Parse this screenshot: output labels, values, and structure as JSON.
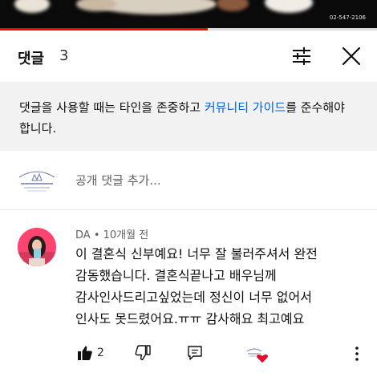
{
  "video": {
    "corner_text": "02-547-2106",
    "progress_percent": 55
  },
  "header": {
    "title": "댓글",
    "count": "3",
    "sort_icon": "sort-sliders-icon",
    "close_icon": "close-icon"
  },
  "notice": {
    "text_before": "댓글을 사용할 때는 타인을 존중하고 ",
    "link_text": "커뮤니티 가이드",
    "text_after": "를 준수해야 합니다."
  },
  "add_comment": {
    "placeholder": "공개 댓글 추가..."
  },
  "comments": [
    {
      "author": "DA",
      "time": "10개월 전",
      "lines": [
        "이 결혼식 신부예요!  너무 잘 불러주셔서 완전",
        "감동했습니다. 결혼식끝나고 배우님께",
        "감사인사드리고싶었는데 정신이 너무 없어서",
        "인사도 못드렸어요.ㅠㅠ 감사해요 최고예요"
      ],
      "likes": "2"
    }
  ],
  "colors": {
    "link": "#065fd4",
    "notice_bg": "#f2f2f2",
    "progress": "#ff0000",
    "heart": "#e0102a"
  }
}
